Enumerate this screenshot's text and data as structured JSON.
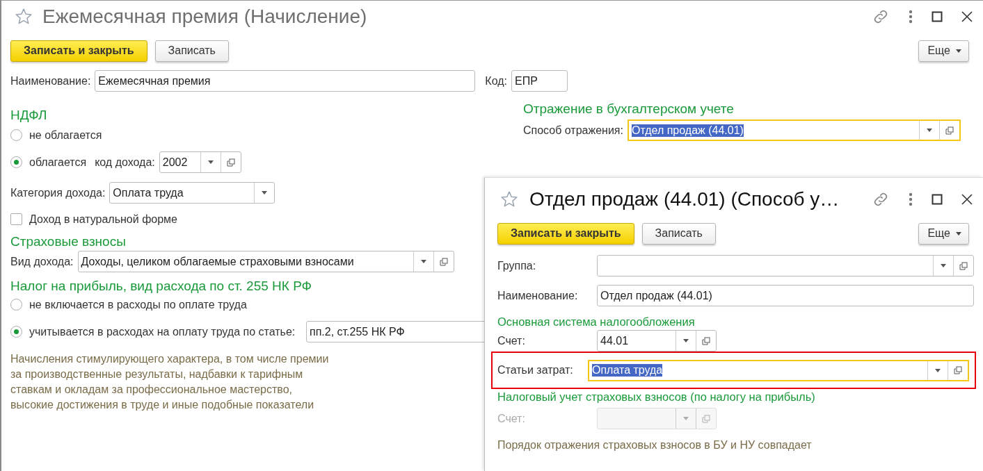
{
  "main_window": {
    "title": "Ежемесячная премия (Начисление)",
    "toolbar": {
      "primary": "Записать и закрыть",
      "secondary": "Записать",
      "more": "Еще"
    },
    "name_field": {
      "label": "Наименование:",
      "value": "Ежемесячная премия"
    },
    "code_field": {
      "label": "Код:",
      "value": "ЕПР"
    },
    "ndfl": {
      "heading": "НДФЛ",
      "options": [
        {
          "label": "не облагается",
          "selected": false
        },
        {
          "label": "облагается",
          "selected": true
        }
      ],
      "income_code": {
        "label": "код дохода:",
        "value": "2002"
      },
      "income_category": {
        "label": "Категория дохода:",
        "value": "Оплата труда"
      },
      "in_kind": {
        "label": "Доход в натуральной форме",
        "checked": false
      }
    },
    "insurance": {
      "heading": "Страховые взносы",
      "income_type": {
        "label": "Вид дохода:",
        "value": "Доходы, целиком облагаемые страховыми взносами"
      }
    },
    "profit_tax": {
      "heading": "Налог на прибыль, вид расхода по ст. 255 НК РФ",
      "options": [
        {
          "label": "не включается в расходы по оплате труда",
          "selected": false
        },
        {
          "label": "учитывается в расходах на оплату труда по статье:",
          "selected": true
        }
      ],
      "article_field": {
        "value": "пп.2, ст.255 НК РФ"
      },
      "note": "Начисления стимулирующего характера, в том числе премии\nза производственные результаты, надбавки к тарифным\nставкам и окладам за профессиональное мастерство,\nвысокие достижения в труде и иные подобные показатели"
    },
    "accounting": {
      "heading": "Отражение в бухгалтерском учете",
      "method": {
        "label": "Способ отражения:",
        "value": "Отдел продаж (44.01)",
        "focused": true
      }
    }
  },
  "dialog": {
    "title": "Отдел продаж (44.01) (Способ у…",
    "toolbar": {
      "primary": "Записать и закрыть",
      "secondary": "Записать",
      "more": "Еще"
    },
    "group_field": {
      "label": "Группа:"
    },
    "name_field": {
      "label": "Наименование:",
      "value": "Отдел продаж (44.01)"
    },
    "main_tax": {
      "heading": "Основная система налогообложения",
      "account": {
        "label": "Счет:",
        "value": "44.01",
        "disabled": false
      },
      "cost_items": {
        "label": "Статьи затрат:",
        "value": "Оплата труда",
        "focused": true,
        "highlighted": true
      }
    },
    "insurance_tax": {
      "heading": "Налоговый учет страховых взносов (по налогу на прибыль)",
      "account": {
        "label": "Счет:",
        "disabled": true
      }
    },
    "note": "Порядок отражения страховых взносов в БУ и НУ совпадает"
  }
}
